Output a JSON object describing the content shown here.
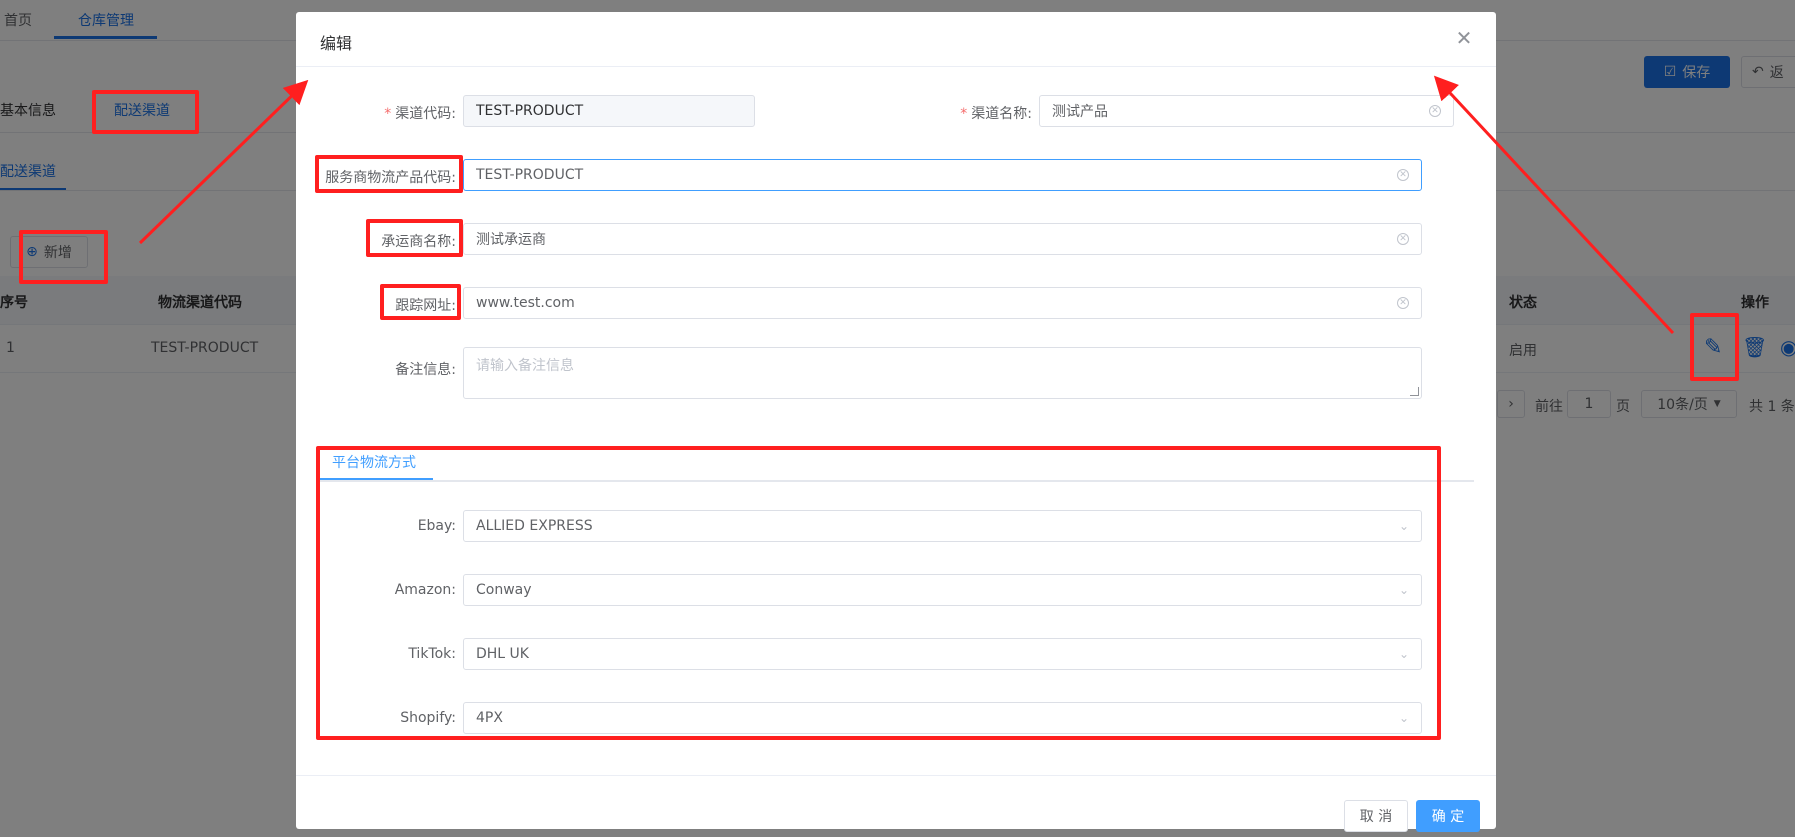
{
  "background": {
    "top_tabs": [
      "首页",
      "仓库管理"
    ],
    "info_tabs": [
      "基本信息",
      "配送渠道"
    ],
    "sub_tab": "配送渠道",
    "save_button": "保存",
    "return_button": "返",
    "add_button": "新增",
    "table": {
      "columns": {
        "index": "序号",
        "code": "物流渠道代码",
        "status": "状态",
        "actions": "操作"
      },
      "rows": [
        {
          "index": "1",
          "code": "TEST-PRODUCT",
          "status": "启用"
        }
      ]
    },
    "pagination": {
      "goto_label": "前往",
      "page": "1",
      "page_suffix": "页",
      "page_size": "10条/页",
      "total": "共 1 条"
    }
  },
  "dialog": {
    "title": "编辑",
    "fields": {
      "channel_code": {
        "label": "渠道代码:",
        "value": "TEST-PRODUCT"
      },
      "channel_name": {
        "label": "渠道名称:",
        "value": "测试产品"
      },
      "provider_code": {
        "label": "服务商物流产品代码:",
        "value": "TEST-PRODUCT"
      },
      "carrier_name": {
        "label": "承运商名称:",
        "value": "测试承运商"
      },
      "tracking_url": {
        "label": "跟踪网址:",
        "value": "www.test.com"
      },
      "remark": {
        "label": "备注信息:",
        "placeholder": "请输入备注信息"
      }
    },
    "tab": "平台物流方式",
    "platforms": [
      {
        "label": "Ebay:",
        "value": "ALLIED EXPRESS"
      },
      {
        "label": "Amazon:",
        "value": "Conway"
      },
      {
        "label": "TikTok:",
        "value": "DHL UK"
      },
      {
        "label": "Shopify:",
        "value": "4PX"
      }
    ],
    "cancel_button": "取 消",
    "confirm_button": "确 定"
  },
  "colors": {
    "primary": "#409eff",
    "annotation_red": "#ff1f1f",
    "required": "#f56c6c"
  }
}
